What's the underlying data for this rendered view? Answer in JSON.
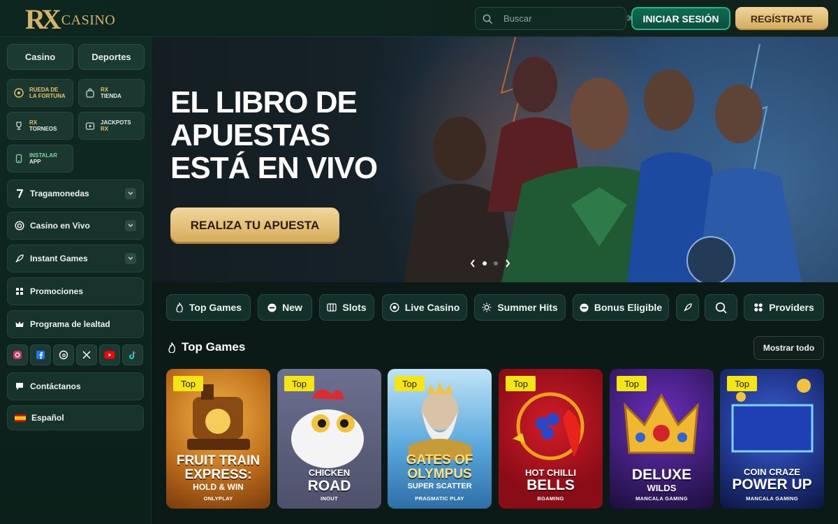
{
  "header": {
    "logo_rx": "RX",
    "logo_casino": "CASINO",
    "search_placeholder": "Buscar",
    "search_shortcut": "⌘K",
    "login_label": "INICIAR SESIÓN",
    "register_label": "REGÍSTRATE"
  },
  "sidebar": {
    "tabs": [
      {
        "label": "Casino"
      },
      {
        "label": "Deportes"
      }
    ],
    "tiles": [
      {
        "line1": "RUEDA DE",
        "line2": "LA FORTUNA",
        "icon": "wheel-icon"
      },
      {
        "line1": "RX",
        "line2": "TIENDA",
        "icon": "shopping-bag-icon"
      },
      {
        "line1": "RX",
        "line2": "TORNEOS",
        "icon": "trophy-icon"
      },
      {
        "line1": "JACKPOTS",
        "line2": "RX",
        "icon": "jackpot-icon"
      },
      {
        "line1": "INSTALAR",
        "line2": "APP",
        "icon": "phone-icon"
      }
    ],
    "nav": [
      {
        "label": "Tragamonedas",
        "icon": "seven-icon"
      },
      {
        "label": "Casino en Vivo",
        "icon": "chip-icon"
      },
      {
        "label": "Instant Games",
        "icon": "rocket-icon"
      },
      {
        "label": "Promociones",
        "icon": "grid-icon"
      },
      {
        "label": "Programa de lealtad",
        "icon": "crown-icon"
      },
      {
        "label": "Contáctanos",
        "icon": "chat-icon"
      },
      {
        "label": "Español",
        "icon": "spain-flag-icon"
      }
    ],
    "socials": [
      "instagram-icon",
      "facebook-icon",
      "threads-icon",
      "x-icon",
      "youtube-icon",
      "tiktok-icon"
    ]
  },
  "hero": {
    "title_lines": [
      "EL LIBRO DE",
      "APUESTAS",
      "ESTÁ EN VIVO"
    ],
    "cta_label": "REALIZA TU APUESTA",
    "slide_count": 2,
    "active_slide": 1
  },
  "categories": [
    {
      "label": "Top Games",
      "icon": "flame-icon"
    },
    {
      "label": "New",
      "icon": "new-icon"
    },
    {
      "label": "Slots",
      "icon": "slots-icon"
    },
    {
      "label": "Live Casino",
      "icon": "chip-icon"
    },
    {
      "label": "Summer Hits",
      "icon": "sun-icon"
    },
    {
      "label": "Bonus Eligible",
      "icon": "bonus-icon"
    },
    {
      "label": "",
      "icon": "rocket-icon"
    },
    {
      "label": "",
      "icon": "search-icon"
    },
    {
      "label": "Providers",
      "icon": "grid-icon"
    }
  ],
  "section": {
    "title": "Top Games",
    "show_all_label": "Mostrar todo"
  },
  "games": [
    {
      "badge": "Top",
      "title_lines": [
        "FRUIT TRAIN",
        "EXPRESS:"
      ],
      "subtitle": "HOLD & WIN",
      "provider": "ONLYPLAY",
      "bg": "#c77a1f"
    },
    {
      "badge": "Top",
      "title_lines": [
        "CHICKEN",
        "ROAD"
      ],
      "subtitle": "",
      "provider": "INOUT",
      "bg": "#5c6079"
    },
    {
      "badge": "Top",
      "title_lines": [
        "GATES OF",
        "OLYMPUS"
      ],
      "subtitle": "SUPER SCATTER",
      "provider": "PRAGMATIC PLAY",
      "bg": "#4c8fc9"
    },
    {
      "badge": "Top",
      "title_lines": [
        "HOT CHILLI",
        "BELLS"
      ],
      "subtitle": "",
      "provider": "BGAMING",
      "bg": "#a0101c"
    },
    {
      "badge": "Top",
      "title_lines": [
        "DELUXE",
        "WILDS"
      ],
      "subtitle": "",
      "provider": "MANCALA GAMING",
      "bg": "#3a1c6e"
    },
    {
      "badge": "Top",
      "title_lines": [
        "COIN CRAZE",
        "POWER UP"
      ],
      "subtitle": "",
      "provider": "MANCALA GAMING",
      "bg": "#1b2e7a"
    }
  ],
  "colors": {
    "accent_gold": "#d7b36a",
    "accent_green": "#2bb08a",
    "badge_yellow": "#f6e514"
  }
}
